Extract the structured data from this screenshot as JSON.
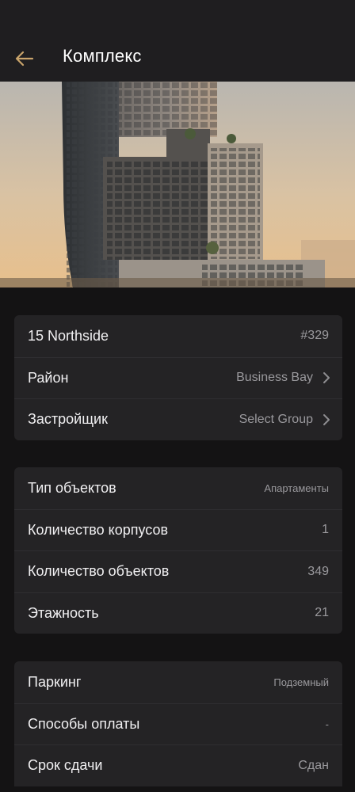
{
  "header": {
    "title": "Комплекс",
    "back_icon": "arrow-left-icon",
    "accent_color": "#c9a46b"
  },
  "hero": {
    "image_subject": "residential-tower-building-photo"
  },
  "card_main": {
    "rows": [
      {
        "label": "15 Northside",
        "value": "#329"
      },
      {
        "label": "Район",
        "value": "Business Bay",
        "icon": "chevron-right-icon"
      },
      {
        "label": "Застройщик",
        "value": "Select Group",
        "icon": "chevron-right-icon"
      }
    ]
  },
  "card_details": {
    "rows": [
      {
        "label": "Тип объектов",
        "value": "Апартаменты"
      },
      {
        "label": "Количество корпусов",
        "value": "1"
      },
      {
        "label": "Количество объектов",
        "value": "349"
      },
      {
        "label": "Этажность",
        "value": "21"
      }
    ]
  },
  "card_extra": {
    "rows": [
      {
        "label": "Паркинг",
        "value": "Подземный"
      },
      {
        "label": "Способы оплаты",
        "value": "-"
      },
      {
        "label": "Срок сдачи",
        "value": "Сдан"
      }
    ]
  }
}
